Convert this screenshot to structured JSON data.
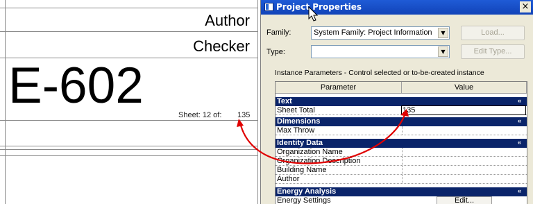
{
  "titleblock": {
    "author": "Author",
    "checker": "Checker",
    "sheet_number": "E-602",
    "sheet_of_prefix": "Sheet: 12 of:",
    "sheet_total": "135"
  },
  "dialog": {
    "title": "Project Properties",
    "close_label": "×",
    "family_label": "Family:",
    "family_value": "System Family: Project Information",
    "load_button": "Load...",
    "type_label": "Type:",
    "type_value": "",
    "edit_type_button": "Edit Type...",
    "instance_caption": "Instance Parameters - Control selected or to-be-created instance",
    "columns": [
      "Parameter",
      "Value"
    ],
    "groups": [
      {
        "name": "Text",
        "collapse_icon": "«",
        "rows": [
          {
            "param": "Sheet Total",
            "value": "135"
          }
        ]
      },
      {
        "name": "Dimensions",
        "collapse_icon": "«",
        "rows": [
          {
            "param": "Max Throw",
            "value": ""
          }
        ]
      },
      {
        "name": "Identity Data",
        "collapse_icon": "«",
        "rows": [
          {
            "param": "Organization Name",
            "value": ""
          },
          {
            "param": "Organization Description",
            "value": ""
          },
          {
            "param": "Building Name",
            "value": ""
          },
          {
            "param": "Author",
            "value": ""
          }
        ]
      },
      {
        "name": "Energy Analysis",
        "collapse_icon": "«",
        "rows": [
          {
            "param": "Energy Settings",
            "value": "Edit..."
          }
        ]
      }
    ]
  },
  "icons": {
    "combo_arrow": "▼",
    "titlebar_app": "project-properties-icon",
    "cursor": "mouse-pointer-icon"
  },
  "colors": {
    "titlebar": "#1f5bd6",
    "group_header": "#0a246a",
    "annotation_arrow": "#e00000",
    "dialog_bg": "#ece9d8"
  }
}
